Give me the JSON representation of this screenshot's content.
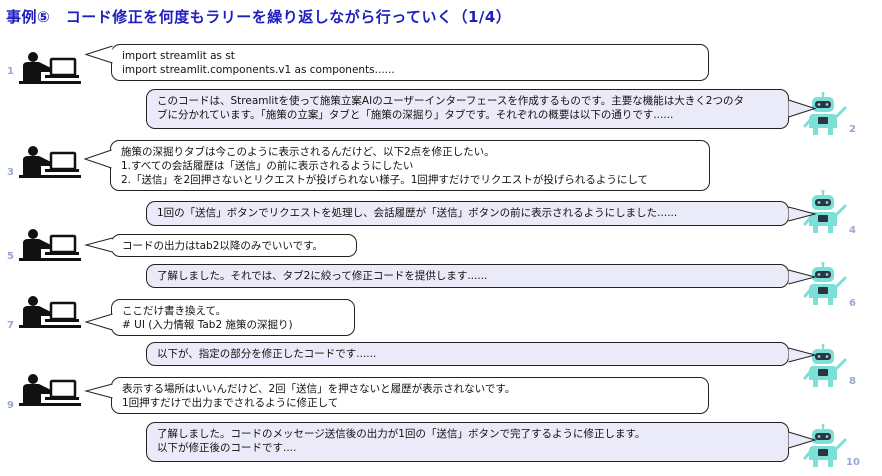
{
  "header": {
    "title": "事例⑤　コード修正を何度もラリーを繰り返しながら行っていく（1/4）"
  },
  "colors": {
    "title": "#1f1fbf",
    "ai_bubble": "#eaeaf8",
    "robot": "#7ce0d6",
    "robot_dark": "#2b3440",
    "number": "#9aa6d8"
  },
  "icons": {
    "user": "person-at-laptop-icon",
    "ai": "robot-icon"
  },
  "messages": [
    {
      "num": "1",
      "role": "user",
      "lines": [
        "import streamlit as st",
        "import streamlit.components.v1 as components......"
      ]
    },
    {
      "num": "2",
      "role": "ai",
      "lines": [
        "このコードは、Streamlitを使って施策立案AIのユーザーインターフェースを作成するものです。主要な機能は大きく2つのタ",
        "ブに分かれています。「施策の立案」タブと「施策の深掘り」タブです。それぞれの概要は以下の通りです......"
      ]
    },
    {
      "num": "3",
      "role": "user",
      "lines": [
        "施策の深掘りタブは今このように表示されるんだけど、以下2点を修正したい。",
        " 1.すべての会話履歴は「送信」の前に表示されるようにしたい",
        " 2.「送信」を2回押さないとリクエストが投げられない様子。1回押すだけでリクエストが投げられるようにして"
      ]
    },
    {
      "num": "4",
      "role": "ai",
      "lines": [
        "1回の「送信」ボタンでリクエストを処理し、会話履歴が「送信」ボタンの前に表示されるようにしました......"
      ]
    },
    {
      "num": "5",
      "role": "user",
      "lines": [
        "コードの出力はtab2以降のみでいいです。"
      ]
    },
    {
      "num": "6",
      "role": "ai",
      "lines": [
        "了解しました。それでは、タブ2に絞って修正コードを提供します......"
      ]
    },
    {
      "num": "7",
      "role": "user",
      "lines": [
        "ここだけ書き換えて。",
        " # UI (入力情報 Tab2 施策の深掘り)"
      ]
    },
    {
      "num": "8",
      "role": "ai",
      "lines": [
        "以下が、指定の部分を修正したコードです......"
      ]
    },
    {
      "num": "9",
      "role": "user",
      "lines": [
        "表示する場所はいいんだけど、2回「送信」を押さないと履歴が表示されないです。",
        "1回押すだけで出力までされるように修正して"
      ]
    },
    {
      "num": "10",
      "role": "ai",
      "lines": [
        "了解しました。コードのメッセージ送信後の出力が1回の「送信」ボタンで完了するように修正します。",
        " 以下が修正後のコードです...."
      ]
    }
  ]
}
